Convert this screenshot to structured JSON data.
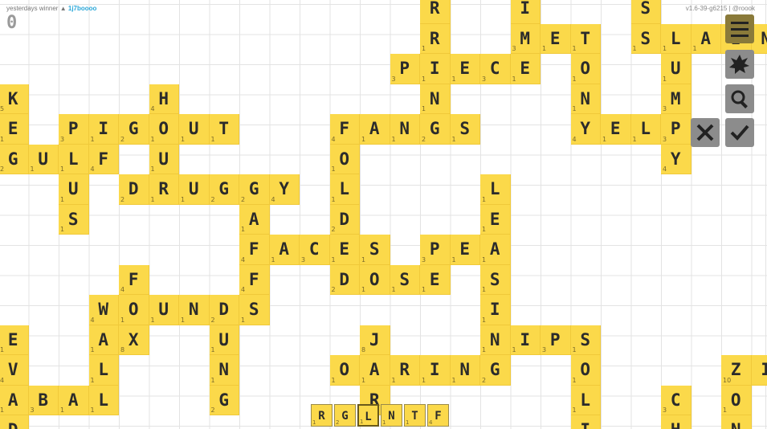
{
  "header": {
    "yesterday_label": "yesterdays winner",
    "winner_name": "1j7boooo",
    "score": "0",
    "version": "v1.6-39-g6215 | @roook"
  },
  "colors": {
    "tile": "#fbd94a",
    "button": "#8c8c8c",
    "grid": "#e3e3e3"
  },
  "board": {
    "tiles": [
      {
        "c": "R",
        "s": "",
        "col": 14,
        "row": 0
      },
      {
        "c": "I",
        "s": "",
        "col": 17,
        "row": 0
      },
      {
        "c": "S",
        "s": "",
        "col": 21,
        "row": 0
      },
      {
        "c": "R",
        "s": "1",
        "col": 14,
        "row": 1
      },
      {
        "c": "M",
        "s": "3",
        "col": 17,
        "row": 1
      },
      {
        "c": "E",
        "s": "1",
        "col": 18,
        "row": 1
      },
      {
        "c": "T",
        "s": "1",
        "col": 19,
        "row": 1
      },
      {
        "c": "S",
        "s": "1",
        "col": 21,
        "row": 1
      },
      {
        "c": "L",
        "s": "1",
        "col": 22,
        "row": 1
      },
      {
        "c": "A",
        "s": "1",
        "col": 23,
        "row": 1
      },
      {
        "c": "I",
        "s": "",
        "col": 24,
        "row": 1
      },
      {
        "c": "N",
        "s": "",
        "col": 25,
        "row": 1
      },
      {
        "c": "P",
        "s": "3",
        "col": 13,
        "row": 2
      },
      {
        "c": "I",
        "s": "1",
        "col": 14,
        "row": 2
      },
      {
        "c": "E",
        "s": "1",
        "col": 15,
        "row": 2
      },
      {
        "c": "C",
        "s": "3",
        "col": 16,
        "row": 2
      },
      {
        "c": "E",
        "s": "1",
        "col": 17,
        "row": 2
      },
      {
        "c": "O",
        "s": "1",
        "col": 19,
        "row": 2
      },
      {
        "c": "U",
        "s": "1",
        "col": 22,
        "row": 2
      },
      {
        "c": "K",
        "s": "5",
        "col": 0,
        "row": 3
      },
      {
        "c": "H",
        "s": "4",
        "col": 5,
        "row": 3
      },
      {
        "c": "N",
        "s": "1",
        "col": 14,
        "row": 3
      },
      {
        "c": "N",
        "s": "1",
        "col": 19,
        "row": 3
      },
      {
        "c": "M",
        "s": "3",
        "col": 22,
        "row": 3
      },
      {
        "c": "E",
        "s": "1",
        "col": 0,
        "row": 4
      },
      {
        "c": "P",
        "s": "3",
        "col": 2,
        "row": 4
      },
      {
        "c": "I",
        "s": "1",
        "col": 3,
        "row": 4
      },
      {
        "c": "G",
        "s": "2",
        "col": 4,
        "row": 4
      },
      {
        "c": "O",
        "s": "1",
        "col": 5,
        "row": 4
      },
      {
        "c": "U",
        "s": "1",
        "col": 6,
        "row": 4
      },
      {
        "c": "T",
        "s": "1",
        "col": 7,
        "row": 4
      },
      {
        "c": "F",
        "s": "4",
        "col": 11,
        "row": 4
      },
      {
        "c": "A",
        "s": "1",
        "col": 12,
        "row": 4
      },
      {
        "c": "N",
        "s": "1",
        "col": 13,
        "row": 4
      },
      {
        "c": "G",
        "s": "2",
        "col": 14,
        "row": 4
      },
      {
        "c": "S",
        "s": "1",
        "col": 15,
        "row": 4
      },
      {
        "c": "Y",
        "s": "4",
        "col": 19,
        "row": 4
      },
      {
        "c": "E",
        "s": "1",
        "col": 20,
        "row": 4
      },
      {
        "c": "L",
        "s": "1",
        "col": 21,
        "row": 4
      },
      {
        "c": "P",
        "s": "3",
        "col": 22,
        "row": 4
      },
      {
        "c": "G",
        "s": "2",
        "col": 0,
        "row": 5
      },
      {
        "c": "U",
        "s": "1",
        "col": 1,
        "row": 5
      },
      {
        "c": "L",
        "s": "1",
        "col": 2,
        "row": 5
      },
      {
        "c": "F",
        "s": "4",
        "col": 3,
        "row": 5
      },
      {
        "c": "U",
        "s": "1",
        "col": 5,
        "row": 5
      },
      {
        "c": "O",
        "s": "1",
        "col": 11,
        "row": 5
      },
      {
        "c": "Y",
        "s": "4",
        "col": 22,
        "row": 5
      },
      {
        "c": "U",
        "s": "1",
        "col": 2,
        "row": 6
      },
      {
        "c": "D",
        "s": "2",
        "col": 4,
        "row": 6
      },
      {
        "c": "R",
        "s": "1",
        "col": 5,
        "row": 6
      },
      {
        "c": "U",
        "s": "1",
        "col": 6,
        "row": 6
      },
      {
        "c": "G",
        "s": "2",
        "col": 7,
        "row": 6
      },
      {
        "c": "G",
        "s": "2",
        "col": 8,
        "row": 6
      },
      {
        "c": "Y",
        "s": "4",
        "col": 9,
        "row": 6
      },
      {
        "c": "L",
        "s": "1",
        "col": 11,
        "row": 6
      },
      {
        "c": "L",
        "s": "1",
        "col": 16,
        "row": 6
      },
      {
        "c": "S",
        "s": "1",
        "col": 2,
        "row": 7
      },
      {
        "c": "A",
        "s": "1",
        "col": 8,
        "row": 7
      },
      {
        "c": "D",
        "s": "2",
        "col": 11,
        "row": 7
      },
      {
        "c": "E",
        "s": "1",
        "col": 16,
        "row": 7
      },
      {
        "c": "F",
        "s": "4",
        "col": 8,
        "row": 8
      },
      {
        "c": "A",
        "s": "1",
        "col": 9,
        "row": 8
      },
      {
        "c": "C",
        "s": "3",
        "col": 10,
        "row": 8
      },
      {
        "c": "E",
        "s": "1",
        "col": 11,
        "row": 8
      },
      {
        "c": "S",
        "s": "1",
        "col": 12,
        "row": 8
      },
      {
        "c": "P",
        "s": "3",
        "col": 14,
        "row": 8
      },
      {
        "c": "E",
        "s": "1",
        "col": 15,
        "row": 8
      },
      {
        "c": "A",
        "s": "1",
        "col": 16,
        "row": 8
      },
      {
        "c": "F",
        "s": "4",
        "col": 4,
        "row": 9
      },
      {
        "c": "F",
        "s": "4",
        "col": 8,
        "row": 9
      },
      {
        "c": "D",
        "s": "2",
        "col": 11,
        "row": 9
      },
      {
        "c": "O",
        "s": "1",
        "col": 12,
        "row": 9
      },
      {
        "c": "S",
        "s": "1",
        "col": 13,
        "row": 9
      },
      {
        "c": "E",
        "s": "1",
        "col": 14,
        "row": 9
      },
      {
        "c": "S",
        "s": "1",
        "col": 16,
        "row": 9
      },
      {
        "c": "W",
        "s": "4",
        "col": 3,
        "row": 10
      },
      {
        "c": "O",
        "s": "1",
        "col": 4,
        "row": 10
      },
      {
        "c": "U",
        "s": "1",
        "col": 5,
        "row": 10
      },
      {
        "c": "N",
        "s": "1",
        "col": 6,
        "row": 10
      },
      {
        "c": "D",
        "s": "2",
        "col": 7,
        "row": 10
      },
      {
        "c": "S",
        "s": "1",
        "col": 8,
        "row": 10
      },
      {
        "c": "I",
        "s": "1",
        "col": 16,
        "row": 10
      },
      {
        "c": "E",
        "s": "1",
        "col": 0,
        "row": 11
      },
      {
        "c": "A",
        "s": "1",
        "col": 3,
        "row": 11
      },
      {
        "c": "X",
        "s": "8",
        "col": 4,
        "row": 11
      },
      {
        "c": "U",
        "s": "1",
        "col": 7,
        "row": 11
      },
      {
        "c": "J",
        "s": "8",
        "col": 12,
        "row": 11
      },
      {
        "c": "N",
        "s": "1",
        "col": 16,
        "row": 11
      },
      {
        "c": "I",
        "s": "1",
        "col": 17,
        "row": 11
      },
      {
        "c": "P",
        "s": "3",
        "col": 18,
        "row": 11
      },
      {
        "c": "S",
        "s": "1",
        "col": 19,
        "row": 11
      },
      {
        "c": "V",
        "s": "4",
        "col": 0,
        "row": 12
      },
      {
        "c": "L",
        "s": "1",
        "col": 3,
        "row": 12
      },
      {
        "c": "N",
        "s": "1",
        "col": 7,
        "row": 12
      },
      {
        "c": "O",
        "s": "1",
        "col": 11,
        "row": 12
      },
      {
        "c": "A",
        "s": "1",
        "col": 12,
        "row": 12
      },
      {
        "c": "R",
        "s": "1",
        "col": 13,
        "row": 12
      },
      {
        "c": "I",
        "s": "1",
        "col": 14,
        "row": 12
      },
      {
        "c": "N",
        "s": "1",
        "col": 15,
        "row": 12
      },
      {
        "c": "G",
        "s": "2",
        "col": 16,
        "row": 12
      },
      {
        "c": "O",
        "s": "1",
        "col": 19,
        "row": 12
      },
      {
        "c": "Z",
        "s": "10",
        "col": 24,
        "row": 12
      },
      {
        "c": "I",
        "s": "",
        "col": 25,
        "row": 12
      },
      {
        "c": "A",
        "s": "1",
        "col": 0,
        "row": 13
      },
      {
        "c": "B",
        "s": "3",
        "col": 1,
        "row": 13
      },
      {
        "c": "A",
        "s": "1",
        "col": 2,
        "row": 13
      },
      {
        "c": "L",
        "s": "1",
        "col": 3,
        "row": 13
      },
      {
        "c": "G",
        "s": "2",
        "col": 7,
        "row": 13
      },
      {
        "c": "R",
        "s": "1",
        "col": 12,
        "row": 13
      },
      {
        "c": "L",
        "s": "1",
        "col": 19,
        "row": 13
      },
      {
        "c": "C",
        "s": "3",
        "col": 22,
        "row": 13
      },
      {
        "c": "O",
        "s": "1",
        "col": 24,
        "row": 13
      },
      {
        "c": "D",
        "s": "",
        "col": 0,
        "row": 14
      },
      {
        "c": "I",
        "s": "1",
        "col": 19,
        "row": 14
      },
      {
        "c": "H",
        "s": "4",
        "col": 22,
        "row": 14
      },
      {
        "c": "N",
        "s": "1",
        "col": 24,
        "row": 14
      }
    ]
  },
  "rack": [
    {
      "c": "R",
      "s": "1"
    },
    {
      "c": "G",
      "s": "2"
    },
    {
      "c": "L",
      "s": "1"
    },
    {
      "c": "N",
      "s": "1"
    },
    {
      "c": "T",
      "s": "1"
    },
    {
      "c": "F",
      "s": "4"
    }
  ]
}
